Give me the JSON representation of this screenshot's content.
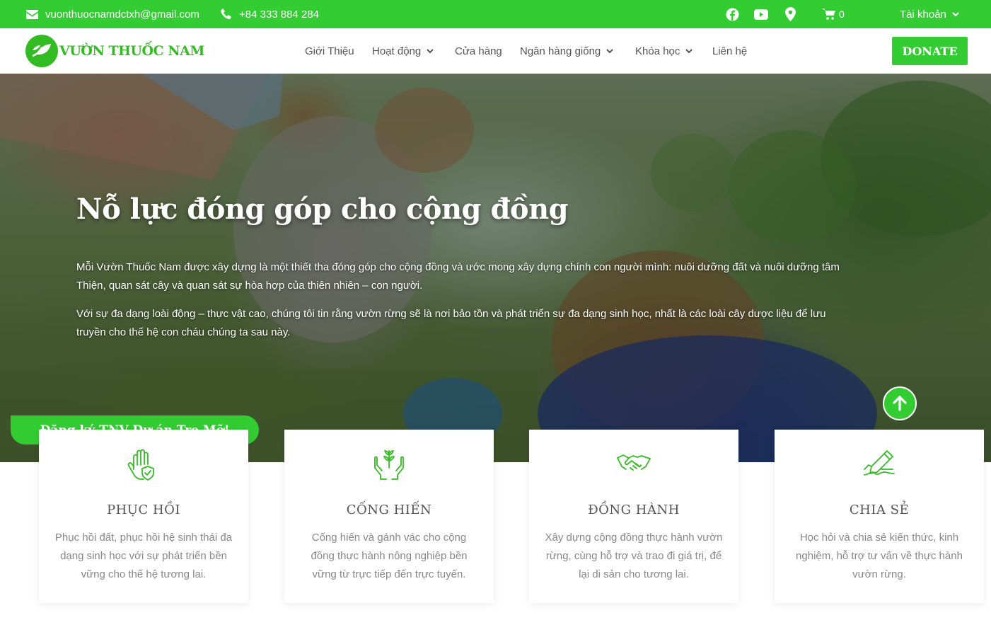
{
  "topbar": {
    "email": "vuonthuocnamdctxh@gmail.com",
    "phone": "+84 333 884 284",
    "cart_count": "0",
    "account_label": "Tài khoản",
    "social_icons": [
      "facebook-icon",
      "youtube-icon",
      "location-icon"
    ]
  },
  "header": {
    "logo_text": "VƯỜN THUỐC NAM",
    "nav": [
      {
        "label": "Giới Thiệu",
        "has_dropdown": false
      },
      {
        "label": "Hoạt động",
        "has_dropdown": true
      },
      {
        "label": "Cửa hàng",
        "has_dropdown": false
      },
      {
        "label": "Ngân hàng giống",
        "has_dropdown": true
      },
      {
        "label": "Khóa học",
        "has_dropdown": true
      },
      {
        "label": "Liên hệ",
        "has_dropdown": false
      }
    ],
    "donate_label": "DONATE"
  },
  "hero": {
    "title": "Nỗ lực đóng góp cho cộng đồng",
    "paragraph1": "Mỗi Vườn Thuốc Nam được xây dựng là một thiết tha đóng góp cho cộng đồng và ước mong xây dựng chính con người mình: nuôi dưỡng đất và nuôi dưỡng tâm Thiện, quan sát cây và quan sát sự hòa hợp của thiên nhiên – con người.",
    "paragraph2": "Với sự đa dạng loài động – thực vật cao, chúng tôi tin rằng vườn rừng sẽ là nơi bảo tồn và phát triển sự đa dạng sinh học, nhất là các loài cây dược liệu để lưu truyền cho thế hệ con cháu chúng ta sau này.",
    "register_label": "Đăng ký TNV Dự án Tre Mỡ!"
  },
  "cards": [
    {
      "icon": "hand-shield-icon",
      "title": "PHỤC HỒI",
      "desc": "Phục hồi đất, phục hồi hệ sinh thái đa dạng sinh học với sự phát triển bền vững cho thế hệ tương lai."
    },
    {
      "icon": "hands-plant-icon",
      "title": "CỐNG HIẾN",
      "desc": "Cống hiến và gánh vác cho cộng đồng thực hành nông nghiệp bền vững từ trực tiếp đến trực tuyến."
    },
    {
      "icon": "handshake-icon",
      "title": "ĐỒNG HÀNH",
      "desc": "Xây dựng cộng đồng thực hành vườn rừng, cùng hỗ trợ và trao đi giá trị, để lại di sản cho tương lai."
    },
    {
      "icon": "hand-writing-icon",
      "title": "CHIA SẺ",
      "desc": "Học hỏi và chia sẻ kiến thức, kinh nghiệm, hỗ trợ tư vấn về thực hành vườn rừng."
    }
  ],
  "colors": {
    "brand_green": "#33cc33",
    "text_gray": "#888888"
  }
}
